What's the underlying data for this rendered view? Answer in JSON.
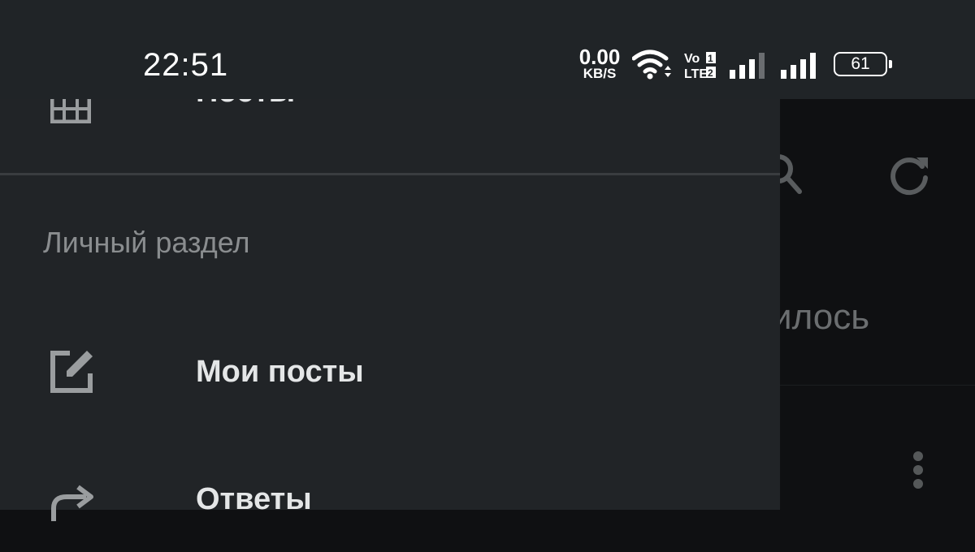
{
  "status_bar": {
    "time": "22:51",
    "net_speed_value": "0.00",
    "net_speed_unit": "KB/S",
    "volte_top": "Vo",
    "volte_bottom": "LTE",
    "sim1": "1",
    "sim2": "2",
    "battery": "61",
    "icons": [
      "wifi-icon",
      "volte-icon",
      "signal-icon",
      "signal-icon",
      "battery-icon"
    ]
  },
  "drawer": {
    "partial_item": {
      "label": "Посты",
      "icon": "grid-icon"
    },
    "section_title": "Личный раздел",
    "items": [
      {
        "label": "Мои посты",
        "icon": "edit-icon"
      },
      {
        "label": "Ответы",
        "icon": "share-arrow-icon"
      }
    ]
  },
  "background": {
    "partial_text": "илось",
    "icons": [
      "search-icon",
      "refresh-icon",
      "more-vertical-icon"
    ]
  },
  "colors": {
    "status_bar_bg": "#202427",
    "drawer_bg": "#212427",
    "background_bg": "#0f1012",
    "text_primary": "#e4e6e7",
    "text_secondary": "#8a8d8f"
  }
}
